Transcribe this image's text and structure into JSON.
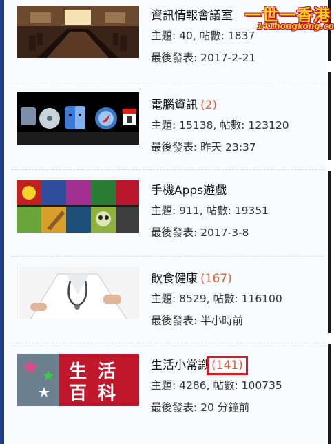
{
  "watermark": {
    "title": "一世一香港",
    "url": "141hongkong.com"
  },
  "forums": [
    {
      "title": "資訊情報會議室",
      "new_count": "",
      "topics_label": "主題: 40, 帖數: 1837",
      "last_post_label": "最後發表: 2017-2-21"
    },
    {
      "title": "電腦資訊",
      "new_count": "(2)",
      "topics_label": "主題: 15138, 帖數: 123120",
      "last_post_label": "最後發表: 昨天 23:37"
    },
    {
      "title": "手機Apps遊戲",
      "new_count": "",
      "topics_label": "主題: 911, 帖數: 19351",
      "last_post_label": "最後發表: 2017-3-8"
    },
    {
      "title": "飲食健康",
      "new_count": "(167)",
      "topics_label": "主題: 8529, 帖數: 116100",
      "last_post_label": "最後發表: 半小時前"
    },
    {
      "title": "生活小常識",
      "new_count": "(141)",
      "topics_label": "主題: 4286, 帖數: 100735",
      "last_post_label": "最後發表: 20 分鐘前"
    }
  ],
  "thumb5_text": [
    "生",
    "活",
    "百",
    "科"
  ],
  "colors": {
    "new_count": "#e35f3b",
    "highlight_box": "#e01822",
    "sidebar": "#1e3f86"
  }
}
